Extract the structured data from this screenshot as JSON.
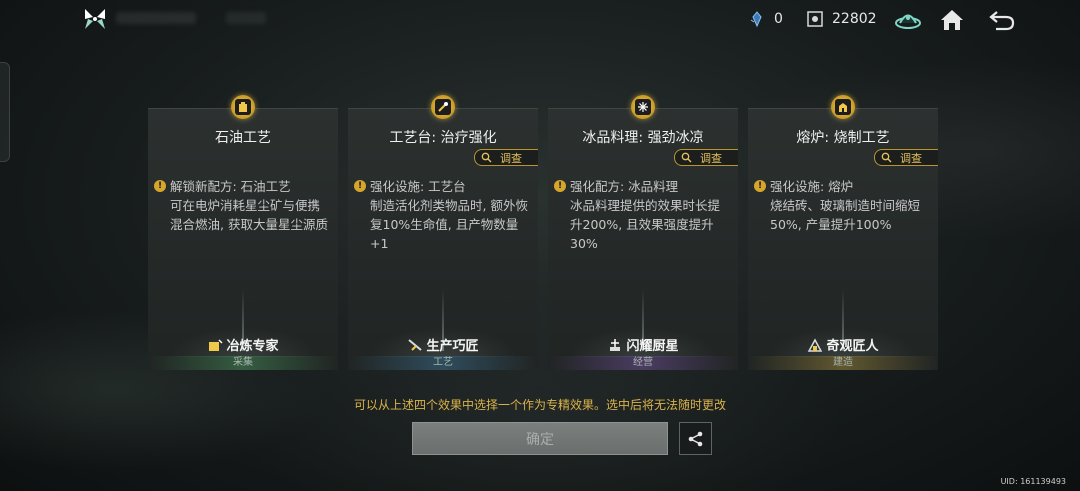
{
  "topbar": {
    "resources": [
      {
        "icon": "crystal-icon",
        "value": "0"
      },
      {
        "icon": "star-dust-icon",
        "value": "22802"
      }
    ]
  },
  "cards": [
    {
      "title": "石油工艺",
      "has_investigate": false,
      "investigate_label": "",
      "effect_lead": "解锁新配方: 石油工艺",
      "effect_body": "可在电炉消耗星尘矿与便携混合燃油, 获取大量星尘源质",
      "skill": "冶炼专家",
      "category": "采集"
    },
    {
      "title": "工艺台: 治疗强化",
      "has_investigate": true,
      "investigate_label": "调查",
      "effect_lead": "强化设施: 工艺台",
      "effect_body": "制造活化剂类物品时, 额外恢复10%生命值, 且产物数量+1",
      "skill": "生产巧匠",
      "category": "工艺"
    },
    {
      "title": "冰品料理: 强劲冰凉",
      "has_investigate": true,
      "investigate_label": "调查",
      "effect_lead": "强化配方: 冰品料理",
      "effect_body": "冰品料理提供的效果时长提升200%, 且效果强度提升30%",
      "skill": "闪耀厨星",
      "category": "经营"
    },
    {
      "title": "熔炉: 烧制工艺",
      "has_investigate": true,
      "investigate_label": "调查",
      "effect_lead": "强化设施: 熔炉",
      "effect_body": "烧结砖、玻璃制造时间缩短50%, 产量提升100%",
      "skill": "奇观匠人",
      "category": "建造"
    }
  ],
  "notice": "可以从上述四个效果中选择一个作为专精效果。选中后将无法随时更改",
  "confirm_label": "确定",
  "uid": "UID: 161139493",
  "colors": {
    "accent_gold": "#d9b24a",
    "card_bg": "#2a2f2e"
  }
}
